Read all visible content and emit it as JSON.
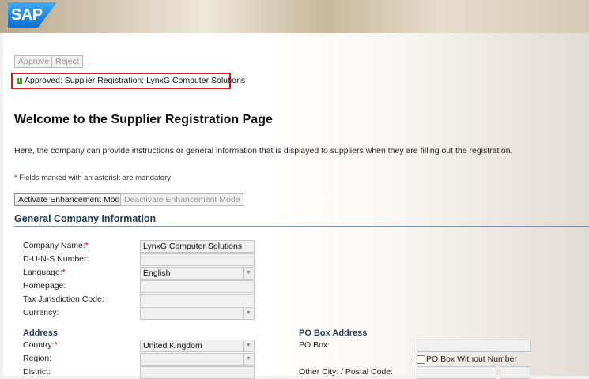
{
  "brand": {
    "logo_text": "SAP"
  },
  "toolbar": {
    "approve_label": "Approve",
    "reject_label": "Reject"
  },
  "message": {
    "icon": "success-icon",
    "text": "Approved: Supplier Registration: LynxG Computer Solutions"
  },
  "page": {
    "title": "Welcome to the Supplier Registration Page",
    "intro": "Here, the company can provide instructions or general information that is displayed to suppliers when they are filling out the registration.",
    "mandatory_star": "*",
    "mandatory_note": " Fields marked with an asterisk are mandatory"
  },
  "enhancement": {
    "activate_label": "Activate Enhancement Mode",
    "deactivate_label": "Deactivate Enhancement Mode"
  },
  "general": {
    "heading": "General Company Information",
    "company_name_label": "Company Name:",
    "company_name_value": "LynxG Computer Solutions",
    "duns_label": "D-U-N-S Number:",
    "duns_value": "",
    "language_label": "Language:",
    "language_value": "English",
    "homepage_label": "Homepage:",
    "homepage_value": "",
    "tax_label": "Tax Jurisdiction Code:",
    "tax_value": "",
    "currency_label": "Currency:",
    "currency_value": "",
    "required_mark": "*"
  },
  "address": {
    "heading": "Address",
    "country_label": "Country:",
    "country_value": "United Kingdom",
    "region_label": "Region:",
    "region_value": "",
    "district_label": "District:",
    "district_value": ""
  },
  "po_box": {
    "heading": "PO Box Address",
    "po_box_label": "PO Box:",
    "po_box_value": "",
    "without_label": "PO Box Without Number",
    "without_checked": false,
    "other_city_label": "Other City: / Postal Code:",
    "other_city_value": "",
    "postal_code_value": ""
  }
}
